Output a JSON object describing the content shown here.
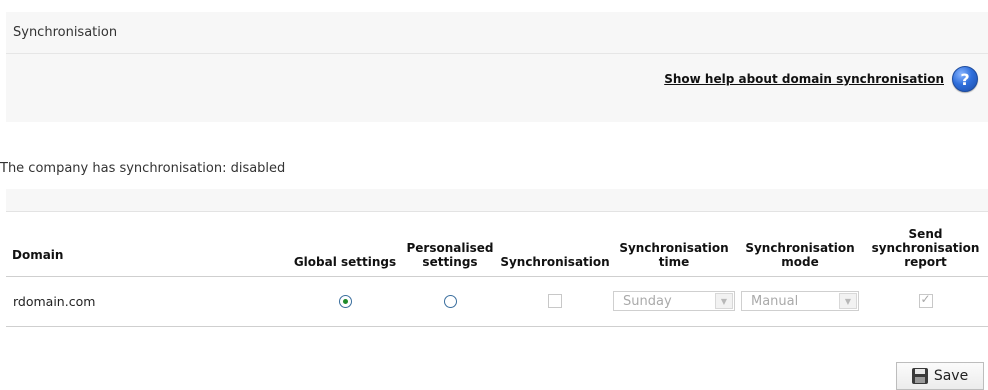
{
  "panel": {
    "title": "Synchronisation",
    "help_link": "Show help about domain synchronisation",
    "help_icon": "help-icon"
  },
  "status_text": "The company has synchronisation: disabled",
  "table": {
    "columns": [
      "Domain",
      "Global settings",
      "Personalised settings",
      "Synchronisation",
      "Synchronisation time",
      "Synchronisation mode",
      "Send synchronisation report"
    ],
    "rows": [
      {
        "domain": "rdomain.com",
        "global_settings": true,
        "personalised_settings": false,
        "synchronisation": false,
        "synchronisation_time": "Sunday",
        "synchronisation_mode": "Manual",
        "send_report": true
      }
    ]
  },
  "save_button": {
    "label": "Save",
    "icon": "floppy-disk-icon"
  }
}
